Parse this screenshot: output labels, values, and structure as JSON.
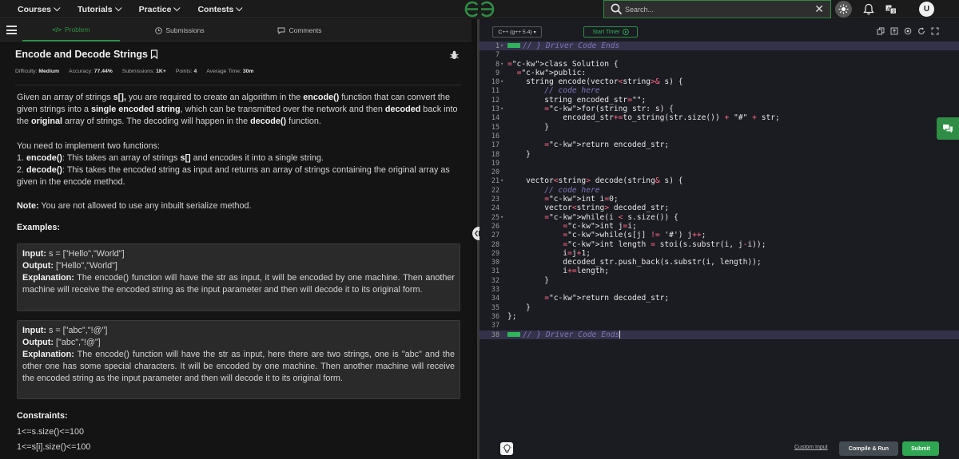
{
  "nav": {
    "items": [
      "Courses",
      "Tutorials",
      "Practice",
      "Contests"
    ],
    "search_placeholder": "Search...",
    "avatar_initial": "U"
  },
  "tabs": {
    "problem": "Problem",
    "submissions": "Submissions",
    "comments": "Comments"
  },
  "problem": {
    "title": "Encode and Decode Strings",
    "meta": {
      "difficulty_label": "Difficulty:",
      "difficulty": "Medium",
      "accuracy_label": "Accuracy:",
      "accuracy": "77.44%",
      "submissions_label": "Submissions:",
      "submissions": "1K+",
      "points_label": "Points:",
      "points": "4",
      "avg_time_label": "Average Time:",
      "avg_time": "30m"
    },
    "intro": {
      "t1": "Given an array of strings ",
      "b1": "s[],",
      "t2": " you are required to create an algorithm in the ",
      "b2": "encode()",
      "t3": " function that can convert the given strings into a ",
      "b3": "single encoded string",
      "t4": ", which can be transmitted over the network and then ",
      "b4": "decoded",
      "t5": " back into the ",
      "b5": "original",
      "t6": " array of strings. The decoding will happen in the ",
      "b6": "decode()",
      "t7": " function."
    },
    "implement": "You need to implement two functions:",
    "f1": {
      "num": "1. ",
      "name": "encode()",
      "t1": ": This takes an array of strings ",
      "b1": "s[]",
      "t2": " and encodes it into a single string."
    },
    "f2": {
      "num": "2. ",
      "name": "decode()",
      "t1": ": This takes the encoded string as input and returns an array of strings containing the original array as given in the encode method."
    },
    "note_label": "Note:",
    "note": " You are not allowed to use any inbuilt serialize method.",
    "examples_label": "Examples:",
    "examples": [
      {
        "input_label": "Input:",
        "input": " s = [\"Hello\",\"World\"]",
        "output_label": "Output:",
        "output": " [\"Hello\",\"World\"]",
        "expl_label": "Explanation:",
        "expl": " The encode() function will have the str as input, it will be encoded by one machine. Then another machine will receive the encoded string as the input parameter and then will decode it to its original form."
      },
      {
        "input_label": "Input:",
        "input": " s = [\"abc\",\"!@\"]",
        "output_label": "Output:",
        "output": " [\"abc\",\"!@\"]",
        "expl_label": "Explanation:",
        "expl": " The encode() function will have the str as input, here there are two strings, one is \"abc\" and the other one has some special characters. It will be encoded by one machine. Then another machine will receive the encoded string as the input parameter and then will decode it to its original form."
      }
    ],
    "constraints_label": "Constraints:",
    "constraints": [
      "1<=s.size()<=100",
      "1<=s[i].size()<=100"
    ]
  },
  "editor": {
    "language": "C++ (g++ 5.4)",
    "timer_label": "Start Timer",
    "custom_input": "Custom Input",
    "compile_label": "Compile & Run",
    "submit_label": "Submit",
    "lines": [
      {
        "n": "1",
        "t": "} Driver Code Ends"
      },
      {
        "n": "7",
        "t": ""
      },
      {
        "n": "8",
        "t": "class Solution {"
      },
      {
        "n": "9",
        "t": "  public:"
      },
      {
        "n": "10",
        "t": "    string encode(vector<string>& s) {"
      },
      {
        "n": "11",
        "t": "        // code here"
      },
      {
        "n": "12",
        "t": "        string encoded_str=\"\";"
      },
      {
        "n": "13",
        "t": "        for(string str: s) {"
      },
      {
        "n": "14",
        "t": "            encoded_str+=to_string(str.size()) + \"#\" + str;"
      },
      {
        "n": "15",
        "t": "        }"
      },
      {
        "n": "16",
        "t": ""
      },
      {
        "n": "17",
        "t": "        return encoded_str;"
      },
      {
        "n": "18",
        "t": "    }"
      },
      {
        "n": "19",
        "t": ""
      },
      {
        "n": "20",
        "t": ""
      },
      {
        "n": "21",
        "t": "    vector<string> decode(string& s) {"
      },
      {
        "n": "22",
        "t": "        // code here"
      },
      {
        "n": "23",
        "t": "        int i=0;"
      },
      {
        "n": "24",
        "t": "        vector<string> decoded_str;"
      },
      {
        "n": "25",
        "t": "        while(i < s.size()) {"
      },
      {
        "n": "26",
        "t": "            int j=i;"
      },
      {
        "n": "27",
        "t": "            while(s[j] != '#') j++;"
      },
      {
        "n": "28",
        "t": "            int length = stoi(s.substr(i, j-i));"
      },
      {
        "n": "29",
        "t": "            i=j+1;"
      },
      {
        "n": "30",
        "t": "            decoded_str.push_back(s.substr(i, length));"
      },
      {
        "n": "31",
        "t": "            i+=length;"
      },
      {
        "n": "32",
        "t": "        }"
      },
      {
        "n": "33",
        "t": ""
      },
      {
        "n": "34",
        "t": "        return decoded_str;"
      },
      {
        "n": "35",
        "t": "    }"
      },
      {
        "n": "36",
        "t": "};"
      },
      {
        "n": "37",
        "t": ""
      },
      {
        "n": "38",
        "t": "} Driver Code Ends"
      }
    ]
  },
  "colors": {
    "brand_green": "#2f8d46",
    "background": "#131313",
    "editor_bg": "#1b1b22"
  }
}
